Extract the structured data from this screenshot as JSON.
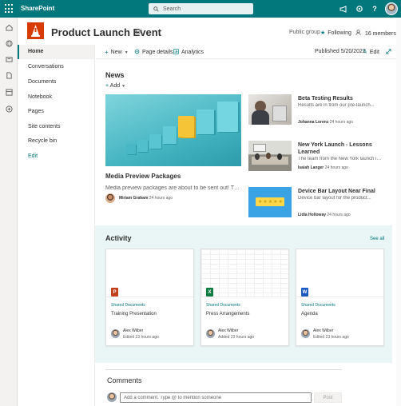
{
  "suite": {
    "brand": "SharePoint",
    "search_placeholder": "Search"
  },
  "site": {
    "title": "Product Launch Event",
    "group_type": "Public group",
    "follow_label": "Following",
    "members_label": "16 members"
  },
  "nav": [
    {
      "label": "Home"
    },
    {
      "label": "Conversations"
    },
    {
      "label": "Documents"
    },
    {
      "label": "Notebook"
    },
    {
      "label": "Pages"
    },
    {
      "label": "Site contents"
    },
    {
      "label": "Recycle bin"
    },
    {
      "label": "Edit"
    }
  ],
  "commandbar": {
    "new_label": "New",
    "page_details_label": "Page details",
    "analytics_label": "Analytics",
    "published": "Published 5/20/2022",
    "edit_label": "Edit"
  },
  "news": {
    "heading": "News",
    "add_label": "Add",
    "hero": {
      "title": "Media Preview Packages",
      "desc": "Media preview packages are about to be sent out! The...",
      "author": "Miriam Graham",
      "time": "24 hours ago"
    },
    "items": [
      {
        "title": "Beta Testing Results",
        "desc": "Results are in from our pre-launch...",
        "author": "Johanna Lorenz",
        "time": "24 hours ago"
      },
      {
        "title": "New York Launch - Lessons Learned",
        "desc": "The team from the New York launch is...",
        "author": "Isaiah Langer",
        "time": "24 hours ago"
      },
      {
        "title": "Device Bar Layout Near Final",
        "desc": "Device bar layout for the product...",
        "author": "Lidia Holloway",
        "time": "24 hours ago"
      }
    ]
  },
  "activity": {
    "heading": "Activity",
    "see_all": "See all",
    "cards": [
      {
        "library": "Shared Documents",
        "name": "Training Presentation",
        "file_type": "P",
        "file_color": "#c43e1c",
        "person": "Alex Wilber",
        "when": "Edited 23 hours ago"
      },
      {
        "library": "Shared Documents",
        "name": "Press Arrangements",
        "file_type": "X",
        "file_color": "#107c41",
        "person": "Alex Wilber",
        "when": "Added 23 hours ago"
      },
      {
        "library": "Shared Documents",
        "name": "Agenda",
        "file_type": "W",
        "file_color": "#185abd",
        "person": "Alex Wilber",
        "when": "Edited 23 hours ago"
      }
    ]
  },
  "comments": {
    "heading": "Comments",
    "placeholder": "Add a comment. Type @ to mention someone",
    "post_label": "Post"
  },
  "colors": {
    "theme": "#03787c",
    "logo": "#d83b01"
  }
}
